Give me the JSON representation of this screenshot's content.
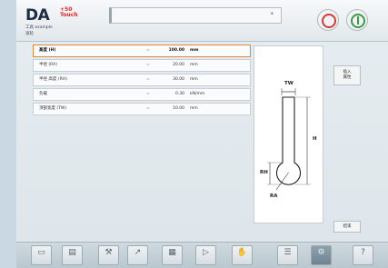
{
  "header": {
    "logo": "DA",
    "logo_sub": "+50",
    "logo_sub2": "Touch",
    "line1": "工具 example",
    "line2": "滚轮",
    "title_mark": "*",
    "stop_icon": "stop-circle-icon",
    "start_icon": "start-power-icon"
  },
  "params": [
    {
      "label": "高度 (H)",
      "eq": "=",
      "value": "100.00",
      "unit": "mm"
    },
    {
      "label": "半径 (RA)",
      "eq": "=",
      "value": "20.00",
      "unit": "mm"
    },
    {
      "label": "半径 高度 (RH)",
      "eq": "=",
      "value": "30.00",
      "unit": "mm"
    },
    {
      "label": "负载",
      "eq": "=",
      "value": "0.30",
      "unit": "kN/mm"
    },
    {
      "label": "顶部宽度 (TW)",
      "eq": "=",
      "value": "10.00",
      "unit": "mm"
    }
  ],
  "drawing": {
    "tw": "TW",
    "h": "H",
    "rh": "RH",
    "ra": "RA"
  },
  "side": {
    "btn1_line1": "插入",
    "btn1_line2": "属性",
    "btn2": "结束"
  },
  "toolbar": {
    "buttons": [
      {
        "icon": "product-icon",
        "glyph": "▭",
        "caption": ""
      },
      {
        "icon": "drawing-icon",
        "glyph": "▤",
        "caption": ""
      },
      {
        "icon": "tool-setup-icon",
        "glyph": "⚒",
        "caption": ""
      },
      {
        "icon": "bend-sequence-icon",
        "glyph": "↗",
        "caption": ""
      },
      {
        "icon": "program-icon",
        "glyph": "▦",
        "caption": ""
      },
      {
        "icon": "auto-icon",
        "glyph": "▷",
        "caption": ""
      },
      {
        "icon": "manual-hand-icon",
        "glyph": "✋",
        "caption": ""
      },
      {
        "icon": "settings-list-icon",
        "glyph": "☰",
        "caption": ""
      },
      {
        "icon": "tools-icon",
        "glyph": "⚙",
        "caption": ""
      },
      {
        "icon": "help-icon",
        "glyph": "?",
        "caption": ""
      }
    ]
  }
}
